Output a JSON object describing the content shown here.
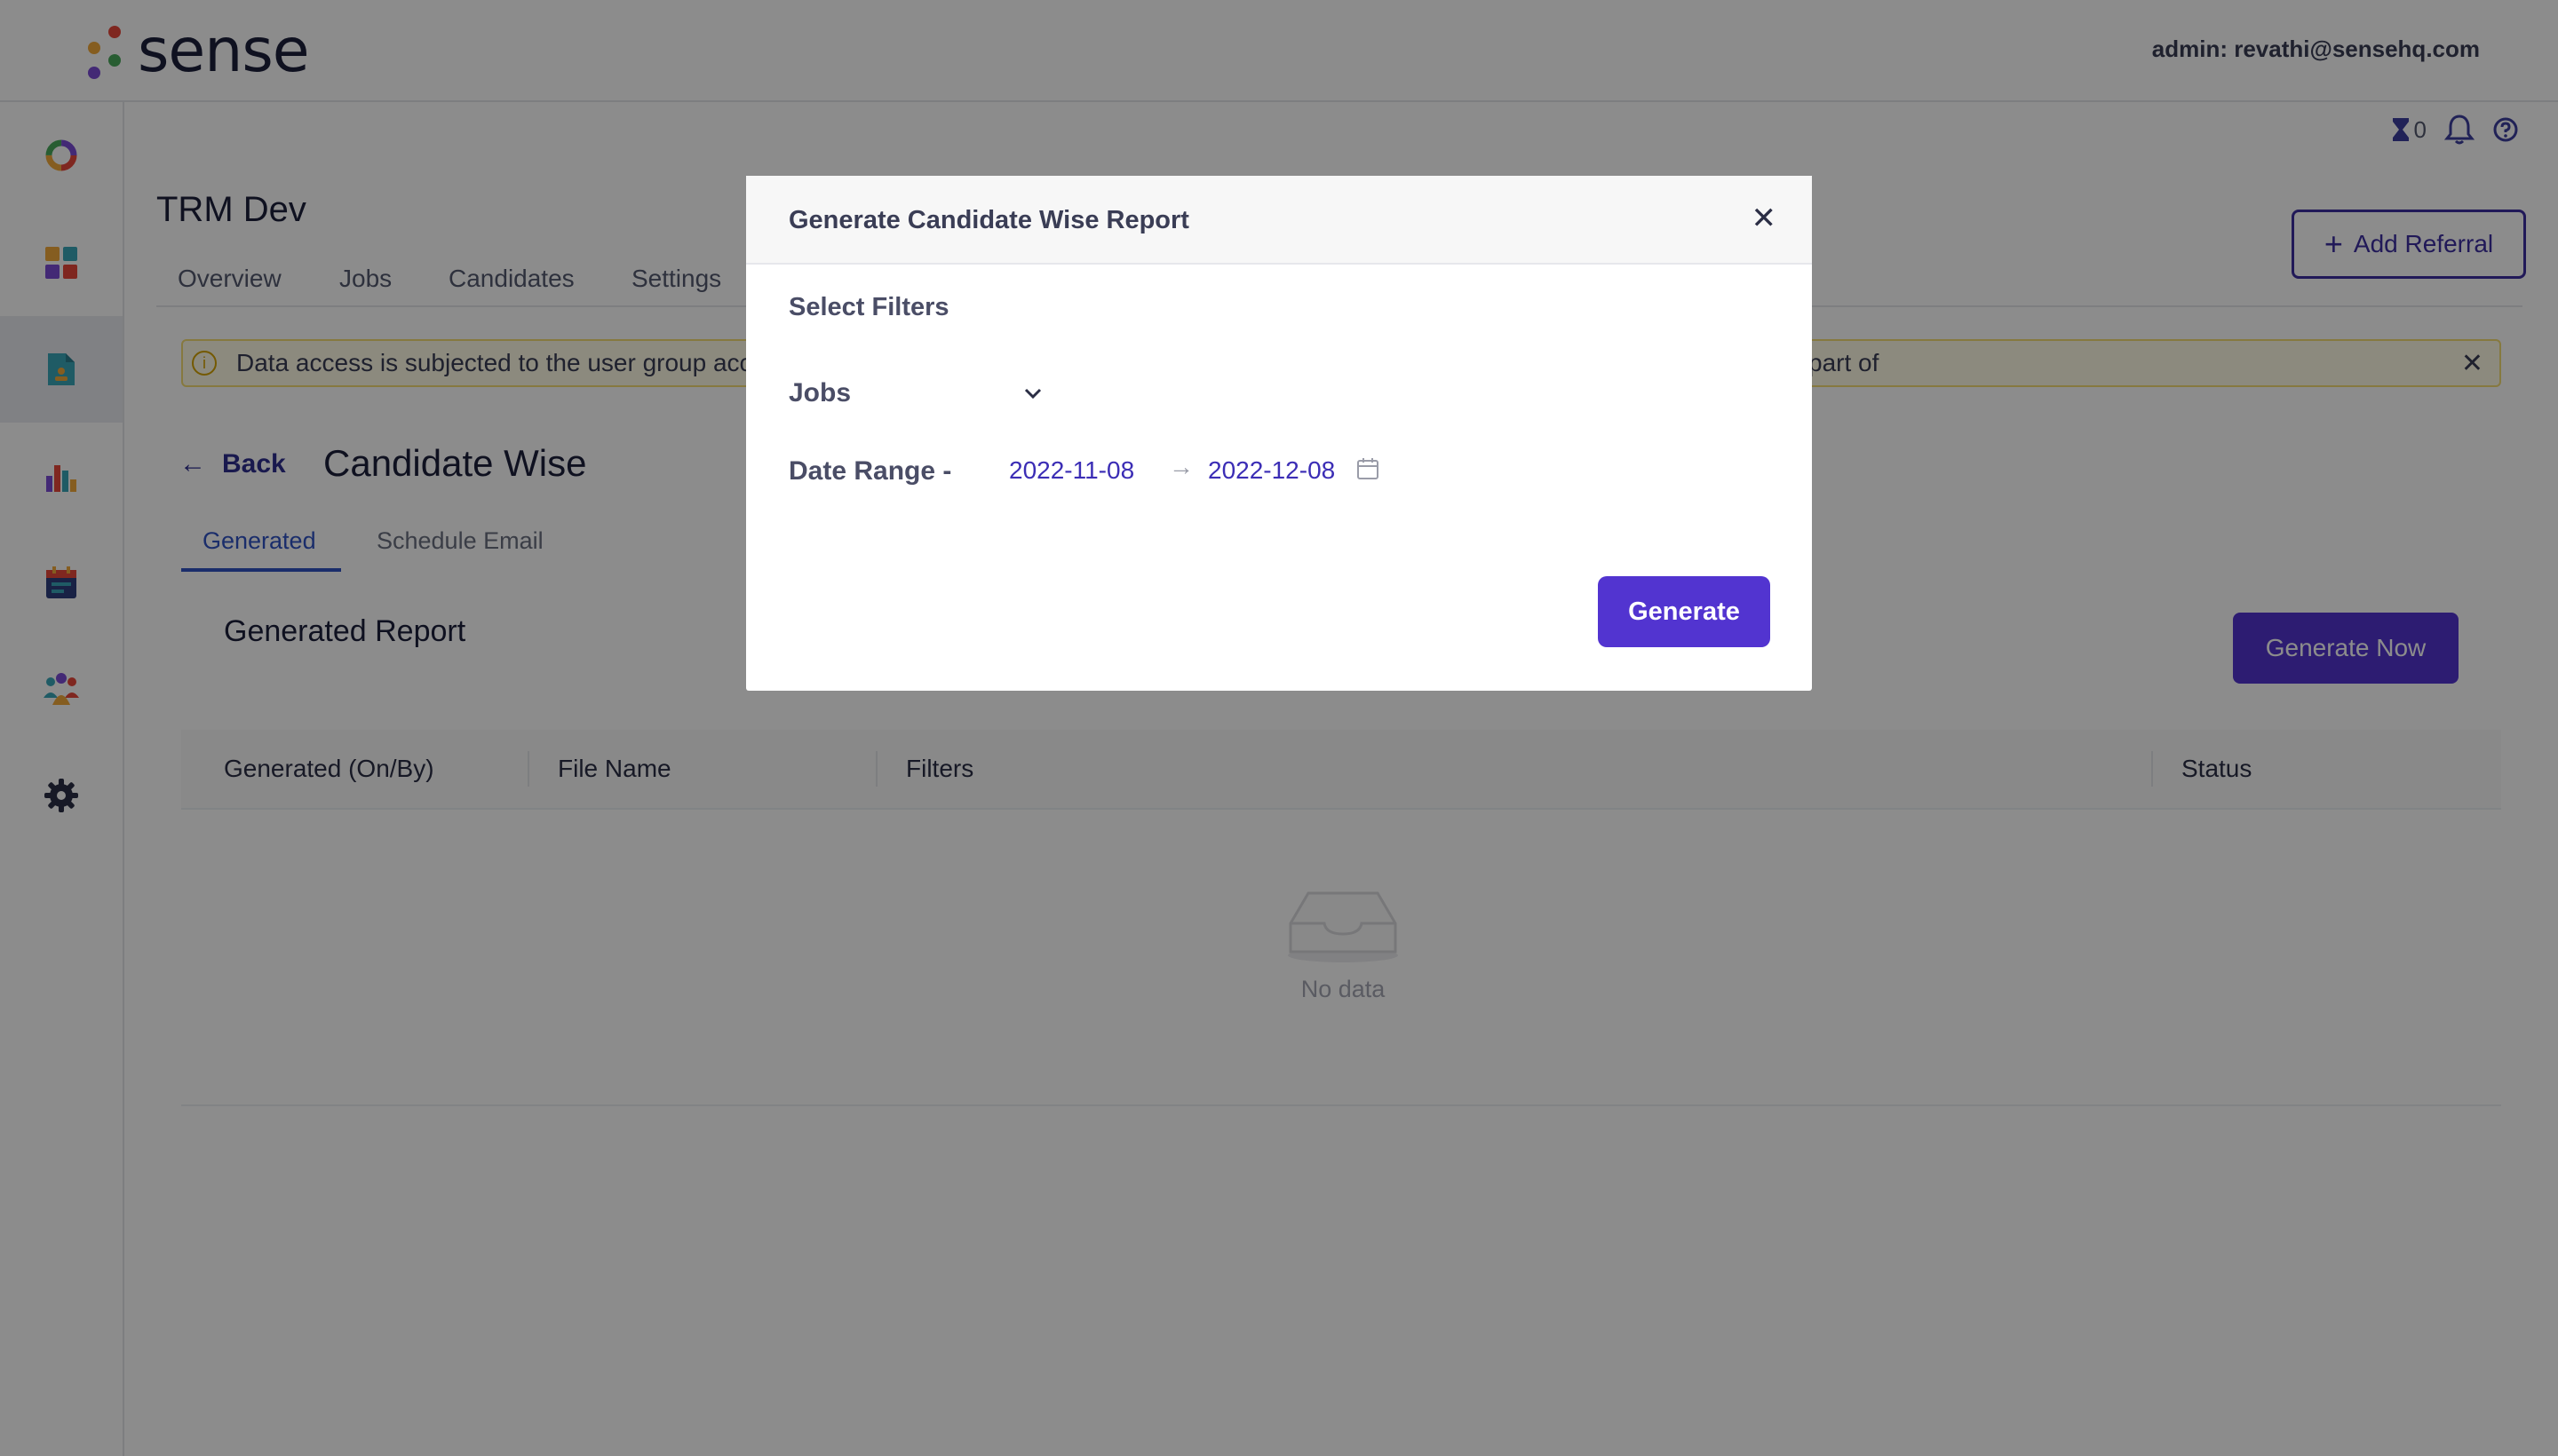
{
  "app": {
    "logo_text": "sense",
    "admin_label": "admin: revathi@sensehq.com"
  },
  "sidebar": {
    "items": [
      {
        "icon": "donut-icon"
      },
      {
        "icon": "dashboard-grid-icon"
      },
      {
        "icon": "report-document-icon",
        "active": true
      },
      {
        "icon": "bar-chart-icon"
      },
      {
        "icon": "calendar-icon"
      },
      {
        "icon": "people-icon"
      },
      {
        "icon": "gear-icon"
      }
    ]
  },
  "utilities": {
    "pending_count": "0"
  },
  "page": {
    "title": "TRM Dev",
    "add_referral_label": "Add Referral",
    "nav_tabs": [
      "Overview",
      "Jobs",
      "Candidates",
      "Settings"
    ],
    "alert_text": "Data access is subjected to the user group acc",
    "alert_text_tail": "part of",
    "back_label": "Back",
    "section_title": "Candidate Wise",
    "sub_tabs": [
      "Generated",
      "Schedule Email"
    ],
    "report_title": "Generated Report",
    "generate_now_label": "Generate Now",
    "table": {
      "headers": [
        "Generated (On/By)",
        "File Name",
        "Filters",
        "Status"
      ],
      "empty_text": "No data"
    }
  },
  "modal": {
    "title": "Generate Candidate Wise Report",
    "close_symbol": "✕",
    "filters_label": "Select Filters",
    "jobs_label": "Jobs",
    "date_range_label": "Date Range -",
    "start_date": "2022-11-08",
    "date_separator": "→",
    "end_date": "2022-12-08",
    "generate_label": "Generate"
  },
  "colors": {
    "primary": "#5234d0",
    "link": "#3153c4",
    "overlay": "rgba(0,0,0,0.45)"
  }
}
